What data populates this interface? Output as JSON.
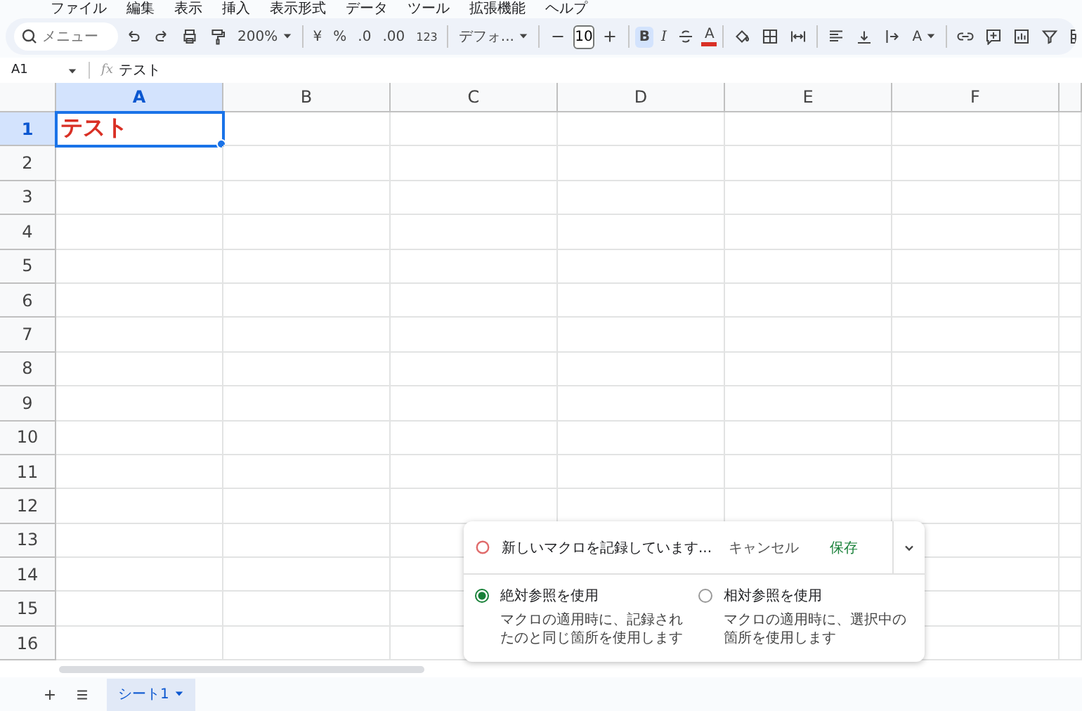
{
  "menu_bar": [
    "ファイル",
    "編集",
    "表示",
    "挿入",
    "表示形式",
    "データ",
    "ツール",
    "拡張機能",
    "ヘルプ"
  ],
  "toolbar": {
    "search_placeholder": "メニュー",
    "zoom": "200%",
    "currency": "¥",
    "percent": "%",
    "decrease_decimal": ".0",
    "increase_decimal": ".00",
    "number_format": "123",
    "font": "デフォ...",
    "font_size": "10",
    "bold": {
      "label": "B",
      "selected": true
    },
    "italic": {
      "label": "I",
      "selected": false
    },
    "text_color": "A",
    "text_rotation": "A"
  },
  "formula_bar": {
    "cell_ref": "A1",
    "fx": "fx",
    "value": "テスト"
  },
  "columns": [
    {
      "label": "A",
      "selected": true
    },
    {
      "label": "B",
      "selected": false
    },
    {
      "label": "C",
      "selected": false
    },
    {
      "label": "D",
      "selected": false
    },
    {
      "label": "E",
      "selected": false
    },
    {
      "label": "F",
      "selected": false
    }
  ],
  "rows": [
    {
      "label": "1",
      "selected": true,
      "value_a": "テスト"
    },
    {
      "label": "2",
      "selected": false
    },
    {
      "label": "3",
      "selected": false
    },
    {
      "label": "4",
      "selected": false
    },
    {
      "label": "5",
      "selected": false
    },
    {
      "label": "6",
      "selected": false
    },
    {
      "label": "7",
      "selected": false
    },
    {
      "label": "8",
      "selected": false
    },
    {
      "label": "9",
      "selected": false
    },
    {
      "label": "10",
      "selected": false
    },
    {
      "label": "11",
      "selected": false
    },
    {
      "label": "12",
      "selected": false
    },
    {
      "label": "13",
      "selected": false
    },
    {
      "label": "14",
      "selected": false
    },
    {
      "label": "15",
      "selected": false
    },
    {
      "label": "16",
      "selected": false
    }
  ],
  "macro_popup": {
    "title": "新しいマクロを記録しています...",
    "cancel": "キャンセル",
    "save": "保存",
    "options": [
      {
        "label": "絶対参照を使用",
        "description": "マクロの適用時に、記録されたのと同じ箇所を使用します",
        "selected": true
      },
      {
        "label": "相対参照を使用",
        "description": "マクロの適用時に、選択中の箇所を使用します",
        "selected": false
      }
    ]
  },
  "sheet_tabs": [
    {
      "label": "シート1",
      "selected": true
    }
  ]
}
